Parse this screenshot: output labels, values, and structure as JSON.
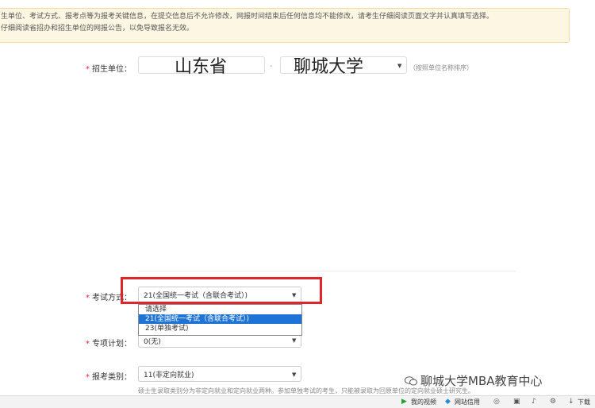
{
  "notice": {
    "line1": "生单位、考试方式、报考点等为报考关键信息，在提交信息后不允许修改，网报时间结束后任何信息均不能修改，请考生仔细阅读页面文字并认真填写选择。",
    "line2": "仔细阅读省招办和招生单位的网报公告，以免导致报名无效。"
  },
  "form": {
    "required_mark": "*",
    "unit_label": "招生单位：",
    "province_value": "山东省",
    "separator": "-",
    "school_value": "聊城大学",
    "unit_hint": "（按照单位名称排序）",
    "exam_label": "考试方式：",
    "exam_selected": "21(全国统一考试（含联合考试）)",
    "exam_options": [
      {
        "label": "请选择",
        "selected": false
      },
      {
        "label": "21(全国统一考试（含联合考试）)",
        "selected": true
      },
      {
        "label": "23(单独考试)",
        "selected": false
      }
    ],
    "plan_label": "专项计划：",
    "plan_value": "0(无)",
    "category_label": "报考类别：",
    "category_value": "11(非定向就业)",
    "category_note": "硕士生录取类别分为非定向就业和定向就业两种。参加单独考试的考生，只能被录取为回原单位的定向就业硕士研究生。"
  },
  "watermark": "聊城大学MBA教育中心",
  "statusbar": {
    "my_video": "我的视频",
    "net_trust": "网站信用",
    "download": "下载"
  },
  "colors": {
    "highlight_border": "#e0242b",
    "selected_option": "#1e73d6",
    "notice_bg": "#fdf6e3"
  }
}
